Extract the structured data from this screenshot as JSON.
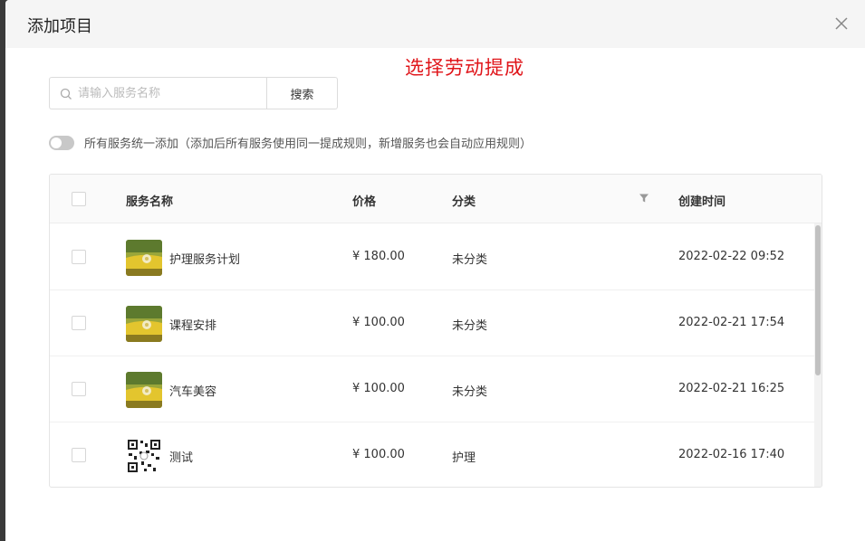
{
  "modal": {
    "title": "添加项目",
    "annotation": "选择劳动提成"
  },
  "search": {
    "placeholder": "请输入服务名称",
    "button_label": "搜索"
  },
  "toggle": {
    "on": false,
    "label": "所有服务统一添加（添加后所有服务使用同一提成规则，新增服务也会自动应用规则）"
  },
  "table": {
    "headers": {
      "name": "服务名称",
      "price": "价格",
      "category": "分类",
      "created": "创建时间"
    },
    "rows": [
      {
        "thumb": "landscape",
        "name": "护理服务计划",
        "price": "¥ 180.00",
        "category": "未分类",
        "created": "2022-02-22 09:52"
      },
      {
        "thumb": "landscape",
        "name": "课程安排",
        "price": "¥ 100.00",
        "category": "未分类",
        "created": "2022-02-21 17:54"
      },
      {
        "thumb": "landscape",
        "name": "汽车美容",
        "price": "¥ 100.00",
        "category": "未分类",
        "created": "2022-02-21 16:25"
      },
      {
        "thumb": "qrcode",
        "name": "测试",
        "price": "¥ 100.00",
        "category": "护理",
        "created": "2022-02-16 17:40"
      }
    ]
  },
  "colors": {
    "annotation": "#e0151a",
    "header_bg": "#f5f5f5",
    "toggle_off": "#c8c8c8"
  }
}
